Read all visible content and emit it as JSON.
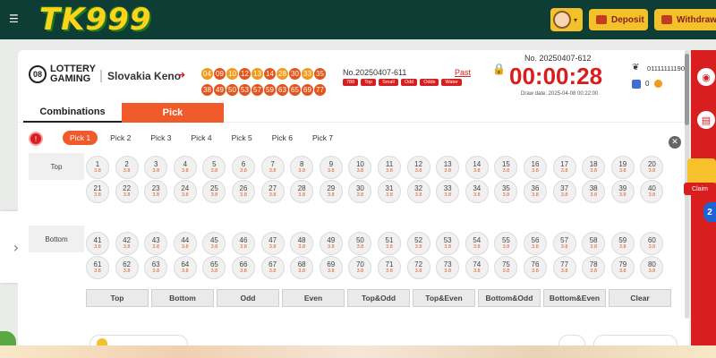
{
  "topbar": {
    "logo": "TK999",
    "deposit_label": "Deposit",
    "withdraw_label": "Withdrawal",
    "avatar_caret": "▾",
    "menu_glyph": "☰"
  },
  "header": {
    "logo_circle": "08",
    "logo_text_1": "LOTTERY",
    "logo_text_2": "GAMING",
    "game_name": "Slovakia Keno",
    "result_numbers_row1": [
      "04",
      "09",
      "10",
      "12",
      "13",
      "14",
      "28",
      "30",
      "33",
      "35"
    ],
    "result_numbers_row2": [
      "38",
      "49",
      "50",
      "53",
      "57",
      "59",
      "63",
      "65",
      "69",
      "77"
    ],
    "current_issue": "No.20250407-611",
    "past_label": "Past",
    "tags": [
      "788",
      "Top",
      "Small",
      "Odd",
      "Odds",
      "Water"
    ],
    "next_issue": "No. 20250407-612",
    "countdown": "00:00:28",
    "draw_date": "Draw date: 2025-04-08 00:22:00",
    "user_id": "01111111190",
    "balance": "0"
  },
  "tabs": {
    "combinations": "Combinations",
    "pick": "Pick"
  },
  "picks": [
    "Pick 1",
    "Pick 2",
    "Pick 3",
    "Pick 4",
    "Pick 5",
    "Pick 6",
    "Pick 7"
  ],
  "info_glyph": "!",
  "close_glyph": "✕",
  "zones": {
    "top": "Top",
    "bottom": "Bottom"
  },
  "odds": "3.8",
  "bet_buttons": [
    "Top",
    "Bottom",
    "Odd",
    "Even",
    "Top&Odd",
    "Top&Even",
    "Bottom&Odd",
    "Bottom&Even",
    "Clear"
  ],
  "colors": {
    "accent": "#f15a2b",
    "brand_red": "#d81e1e",
    "topbar": "#0d3d34",
    "gold": "#f3c22b"
  },
  "icons": [
    "menu-icon",
    "avatar",
    "deposit-icon",
    "withdraw-icon",
    "exit-icon",
    "lock-icon",
    "user-icon",
    "wallet-icon",
    "coin-icon",
    "info-icon",
    "close-icon",
    "chevron-right-icon",
    "globe-icon",
    "document-icon",
    "gift-icon"
  ],
  "left_handle_glyph": "›",
  "lock_glyph": "🔒",
  "exit_glyph": "➜",
  "user_glyph": "❦",
  "right_icons": {
    "globe": "◉",
    "doc": "▤"
  },
  "right_badge": "2",
  "gift_label": "Claim"
}
